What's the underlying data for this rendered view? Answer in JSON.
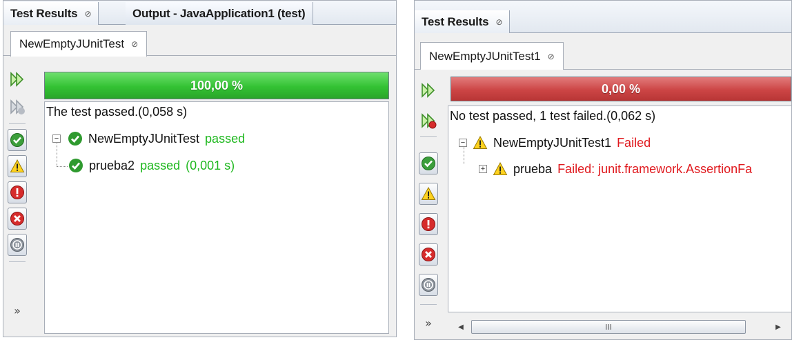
{
  "left": {
    "tabs": [
      {
        "label": "Test Results",
        "close": "⊘"
      },
      {
        "label": "Output - JavaApplication1 (test)"
      }
    ],
    "subtab": {
      "label": "NewEmptyJUnitTest",
      "close": "⊘"
    },
    "progress": {
      "label": "100,00 %",
      "fraction": 1.0,
      "color": "#33c233"
    },
    "summary": "The test passed.(0,058 s)",
    "tree": {
      "root": {
        "name": "NewEmptyJUnitTest",
        "status": "passed"
      },
      "child": {
        "name": "prueba2",
        "status": "passed",
        "time": "(0,001 s)"
      }
    },
    "overflow": "»"
  },
  "right": {
    "tabs": [
      {
        "label": "Test Results",
        "close": "⊘"
      }
    ],
    "subtab": {
      "label": "NewEmptyJUnitTest1",
      "close": "⊘"
    },
    "progress": {
      "label": "0,00 %",
      "fraction": 0.0,
      "color": "#cc4545"
    },
    "summary": "No test passed, 1 test failed.(0,062 s)",
    "tree": {
      "root": {
        "name": "NewEmptyJUnitTest1",
        "status": "Failed"
      },
      "child": {
        "name": "prueba",
        "status": "Failed: junit.framework.AssertionFa"
      }
    },
    "overflow": "»",
    "scrollbar": {
      "thumb": "III"
    }
  },
  "colors": {
    "passed": "#1fb81f",
    "failed": "#e0191e",
    "progress_green": "#33c233",
    "progress_red": "#cc4545"
  },
  "icons": [
    "rerun-icon",
    "rerun-failed-icon",
    "show-passed-icon",
    "show-warnings-icon",
    "show-errors-icon",
    "show-failures-icon",
    "show-skipped-icon",
    "check-icon",
    "warning-icon"
  ]
}
